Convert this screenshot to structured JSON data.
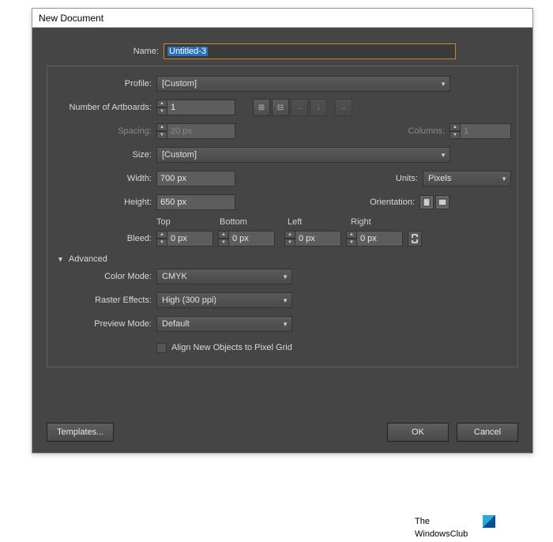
{
  "window": {
    "title": "New Document"
  },
  "labels": {
    "name": "Name:",
    "profile": "Profile:",
    "artboards": "Number of Artboards:",
    "spacing": "Spacing:",
    "columns": "Columns:",
    "size": "Size:",
    "width": "Width:",
    "height": "Height:",
    "units": "Units:",
    "orientation": "Orientation:",
    "bleed": "Bleed:",
    "top": "Top",
    "bottom": "Bottom",
    "left": "Left",
    "right": "Right",
    "advanced": "Advanced",
    "color_mode": "Color Mode:",
    "raster": "Raster Effects:",
    "preview": "Preview Mode:",
    "align": "Align New Objects to Pixel Grid"
  },
  "values": {
    "name": "Untitled-3",
    "profile": "[Custom]",
    "artboards": "1",
    "spacing": "20 px",
    "columns": "1",
    "size": "[Custom]",
    "width": "700 px",
    "height": "650 px",
    "units": "Pixels",
    "bleed_top": "0 px",
    "bleed_bottom": "0 px",
    "bleed_left": "0 px",
    "bleed_right": "0 px",
    "color_mode": "CMYK",
    "raster": "High (300 ppi)",
    "preview": "Default"
  },
  "buttons": {
    "templates": "Templates...",
    "ok": "OK",
    "cancel": "Cancel"
  },
  "watermark": {
    "line1": "The",
    "line2": "WindowsClub"
  }
}
